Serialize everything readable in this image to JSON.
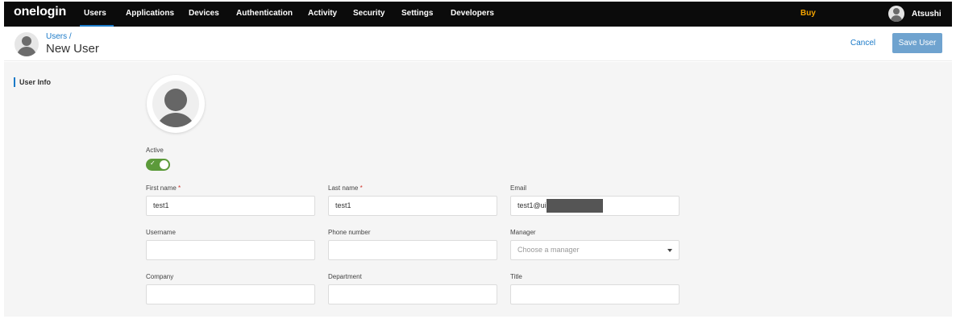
{
  "topnav": {
    "brand": "onelogin",
    "items": [
      "Users",
      "Applications",
      "Devices",
      "Authentication",
      "Activity",
      "Security",
      "Settings",
      "Developers"
    ],
    "active_item": "Users",
    "buy": "Buy",
    "user": "Atsushi",
    "colors": {
      "bar": "#0b0b0b",
      "active_underline": "#1b7ac8",
      "buy": "#f4a300"
    }
  },
  "header": {
    "breadcrumb": "Users /",
    "title": "New User",
    "cancel_label": "Cancel",
    "save_label": "Save User"
  },
  "sidebar": {
    "items": [
      {
        "label": "User Info",
        "active": true
      }
    ]
  },
  "form": {
    "active_label": "Active",
    "active_on": true,
    "fields": {
      "first_name": {
        "label": "First name",
        "required": true,
        "value": "test1"
      },
      "last_name": {
        "label": "Last name",
        "required": true,
        "value": "test1"
      },
      "email": {
        "label": "Email",
        "value": "test1@ui"
      },
      "username": {
        "label": "Username",
        "value": ""
      },
      "phone": {
        "label": "Phone number",
        "value": ""
      },
      "manager": {
        "label": "Manager",
        "placeholder": "Choose a manager"
      },
      "company": {
        "label": "Company",
        "value": ""
      },
      "department": {
        "label": "Department",
        "value": ""
      },
      "title": {
        "label": "Title",
        "value": ""
      }
    },
    "required_mark": "*",
    "toggle_color": "#5c9a3a"
  }
}
